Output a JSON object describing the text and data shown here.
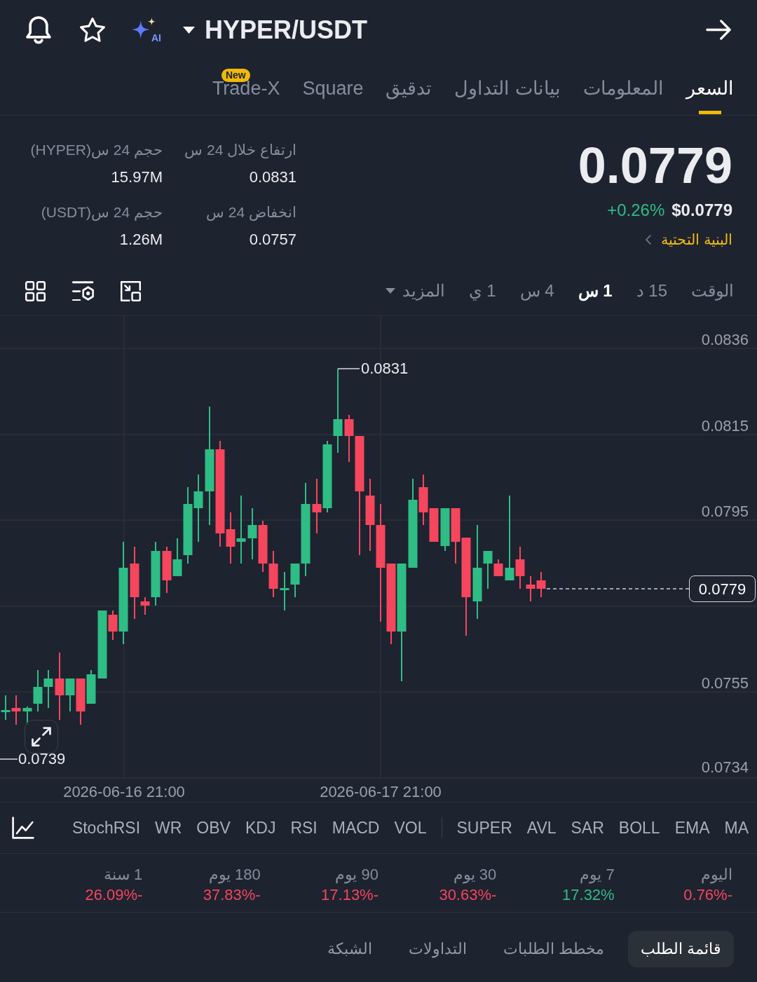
{
  "header": {
    "pair": "HYPER/USDT",
    "ai_label": "AI"
  },
  "tabs": [
    {
      "label": "السعر",
      "selected": true
    },
    {
      "label": "المعلومات",
      "selected": false
    },
    {
      "label": "بيانات التداول",
      "selected": false
    },
    {
      "label": "تدقيق",
      "selected": false
    },
    {
      "label": "Square",
      "selected": false
    },
    {
      "label": "Trade-X",
      "selected": false,
      "badge": "New"
    }
  ],
  "price": {
    "last": "0.0779",
    "change": "+0.26%",
    "color": "#2ebd85",
    "usd": "$0.0779",
    "category": "البنية التحتية"
  },
  "stats": [
    {
      "label": "ارتفاع خلال 24 س",
      "value": "0.0831"
    },
    {
      "label": "حجم 24 س(HYPER)",
      "value": "15.97M"
    },
    {
      "label": "انخفاض 24 س",
      "value": "0.0757"
    },
    {
      "label": "حجم 24 س(USDT)",
      "value": "1.26M"
    }
  ],
  "intervals": [
    {
      "label": "الوقت",
      "kind": "option",
      "selected": false
    },
    {
      "label": "15 د",
      "kind": "option",
      "selected": false
    },
    {
      "label": "1 س",
      "kind": "option",
      "selected": true
    },
    {
      "label": "4 س",
      "kind": "option",
      "selected": false
    },
    {
      "label": "1 ي",
      "kind": "option",
      "selected": false
    },
    {
      "label": "المزيد",
      "kind": "menu",
      "selected": false
    }
  ],
  "chart": {
    "y_labels": [
      "0.0836",
      "0.0815",
      "0.0795",
      "0.0755",
      "0.0734"
    ],
    "x_labels": [
      "2026-06-17 21:00",
      "2026-06-16 21:00"
    ],
    "high_label": "0.0831",
    "low_label": "0.0739",
    "last_price_tag": "0.0779"
  },
  "indicators": {
    "main": [
      "MA",
      "EMA",
      "BOLL",
      "SAR",
      "AVL",
      "SUPER"
    ],
    "sub": [
      "VOL",
      "MACD",
      "RSI",
      "KDJ",
      "OBV",
      "WR",
      "StochRSI"
    ]
  },
  "performance": [
    {
      "period": "اليوم",
      "change": "0.76%-",
      "color": "#f6465d"
    },
    {
      "period": "7 يوم",
      "change": "17.32%",
      "color": "#2ebd85"
    },
    {
      "period": "30 يوم",
      "change": "30.63%-",
      "color": "#f6465d"
    },
    {
      "period": "90 يوم",
      "change": "17.13%-",
      "color": "#f6465d"
    },
    {
      "period": "180 يوم",
      "change": "37.83%-",
      "color": "#f6465d"
    },
    {
      "period": "1 سنة",
      "change": "26.09%-",
      "color": "#f6465d"
    }
  ],
  "bottom_tabs": [
    {
      "label": "قائمة الطلب",
      "selected": true
    },
    {
      "label": "مخطط الطلبات",
      "selected": false
    },
    {
      "label": "التداولات",
      "selected": false
    },
    {
      "label": "الشبكة",
      "selected": false
    }
  ]
}
